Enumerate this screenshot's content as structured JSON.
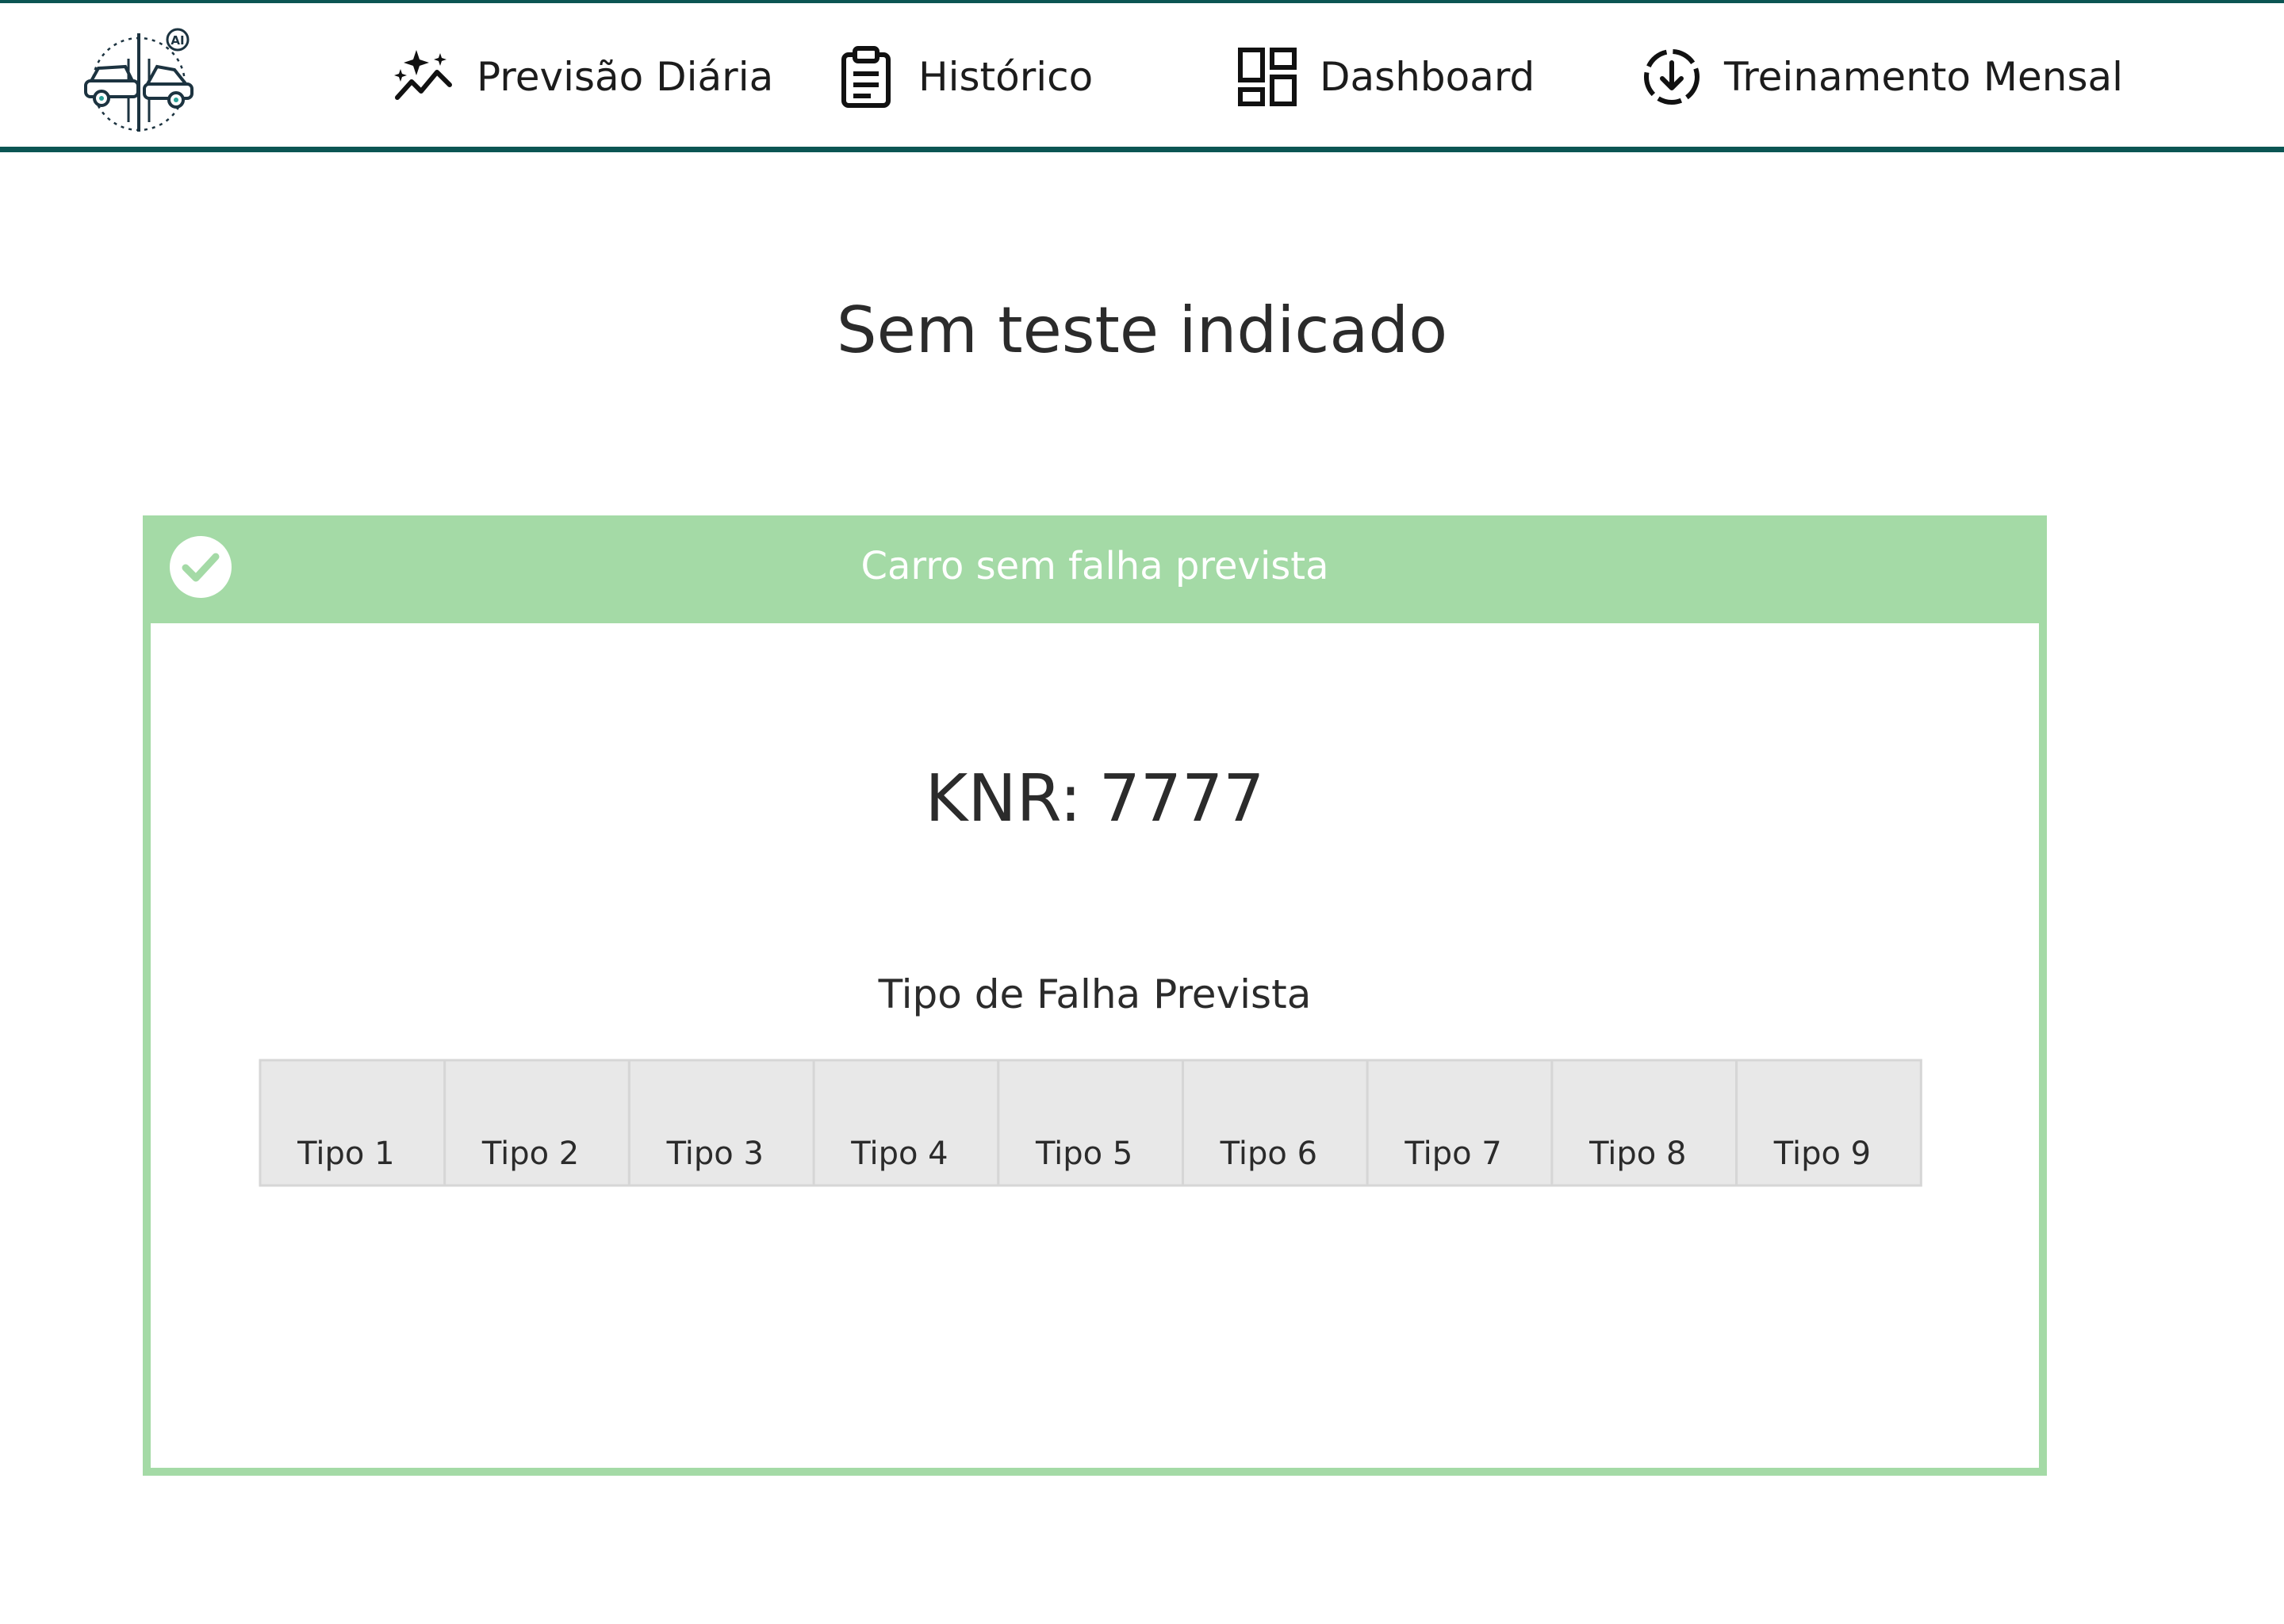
{
  "nav": {
    "items": [
      {
        "label": "Previsão Diária",
        "icon": "sparkle-chart-icon"
      },
      {
        "label": "Histórico",
        "icon": "clipboard-icon"
      },
      {
        "label": "Dashboard",
        "icon": "dashboard-grid-icon"
      },
      {
        "label": "Treinamento Mensal",
        "icon": "download-circle-icon"
      }
    ]
  },
  "logo": {
    "icon": "car-circuit-ai-logo",
    "text": "AI"
  },
  "page": {
    "title": "Sem teste indicado"
  },
  "result": {
    "status": "Carro sem falha prevista",
    "status_icon": "check-circle-icon",
    "knr_label": "KNR:",
    "knr_value": "7777"
  },
  "chart_data": {
    "type": "heatmap",
    "title": "Tipo de Falha Prevista",
    "categories": [
      "Tipo 1",
      "Tipo 2",
      "Tipo 3",
      "Tipo 4",
      "Tipo 5",
      "Tipo 6",
      "Tipo 7",
      "Tipo 8",
      "Tipo 9"
    ],
    "values": [
      0,
      0,
      0,
      0,
      0,
      0,
      0,
      0,
      0
    ],
    "highlighted": []
  },
  "colors": {
    "brand_teal": "#0b5553",
    "success_green": "#a4daa6",
    "cell_empty": "#e8e8e8",
    "cell_border": "#d6d6d6"
  }
}
